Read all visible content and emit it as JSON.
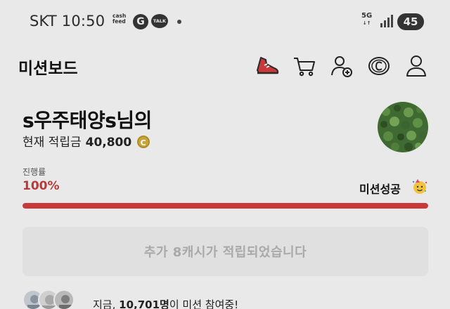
{
  "status_bar": {
    "carrier_time": "SKT 10:50",
    "cashfeed_line1": "cash",
    "cashfeed_line2": "feed",
    "g_icon_letter": "G",
    "talk_icon_text": "TALK",
    "network": "5G",
    "battery": "45"
  },
  "header": {
    "title": "미션보드",
    "icons": [
      "sneaker-icon",
      "cart-icon",
      "add-user-icon",
      "cash-coin-icon",
      "profile-icon"
    ]
  },
  "user": {
    "name": "s우주태양s님의",
    "points_label": "현재 적립금",
    "points_value": "40,800",
    "coin_symbol": "C"
  },
  "progress": {
    "label": "진행률",
    "percent_text": "100%",
    "value": 1.0,
    "status": "미션성공",
    "color": "#c7393b"
  },
  "reward_button": {
    "label": "추가 8캐시가 적립되었습니다"
  },
  "participants": {
    "prefix": "지금, ",
    "count": "10,701명",
    "suffix": "이 미션 참여중!"
  },
  "colors": {
    "background": "#e9e9e9",
    "accent_red": "#c7393b",
    "coin": "#c8a43a"
  }
}
